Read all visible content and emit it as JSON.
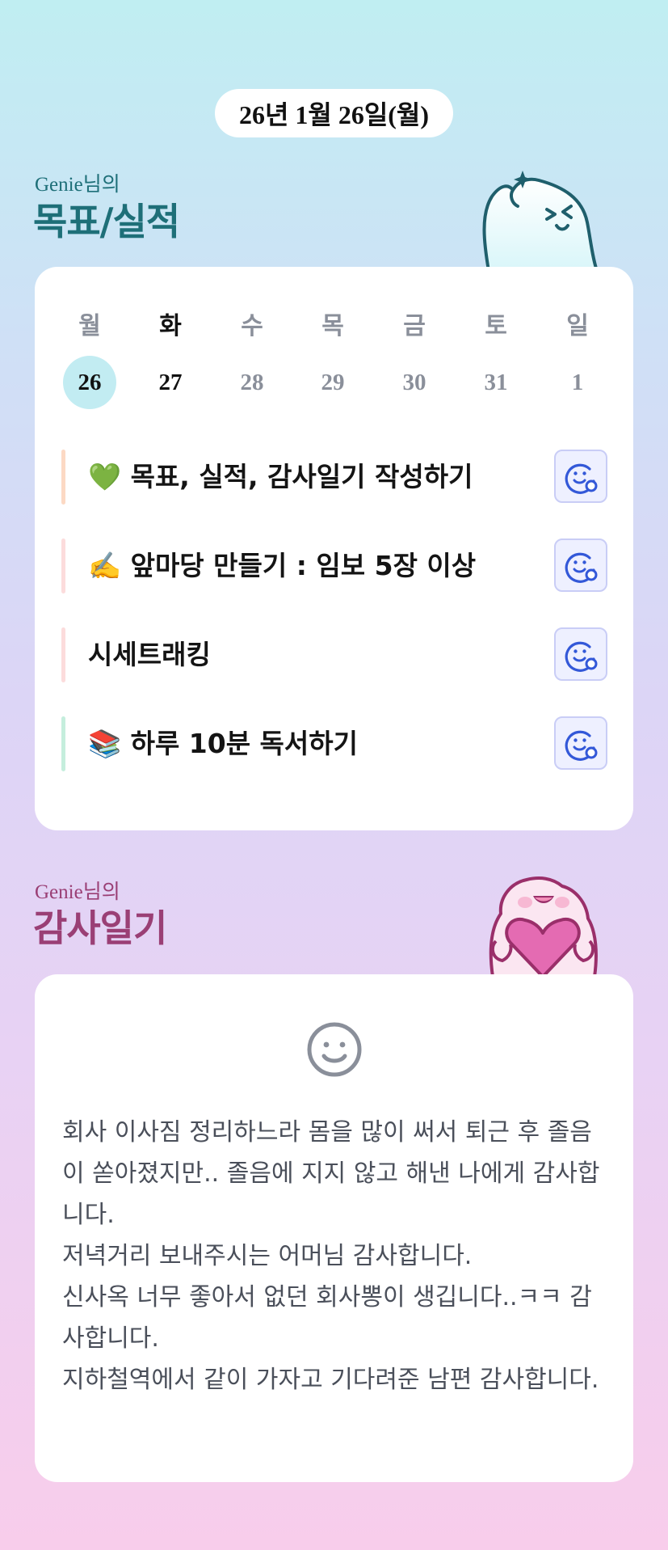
{
  "header": {
    "date": "26년 1월 26일(월)"
  },
  "goals_section": {
    "subtitle": "Genie님의",
    "title": "목표/실적",
    "weekdays": [
      "월",
      "화",
      "수",
      "목",
      "금",
      "토",
      "일"
    ],
    "dates": [
      "26",
      "27",
      "28",
      "29",
      "30",
      "31",
      "1"
    ],
    "selected_index": 0,
    "items": [
      {
        "text": "💚 목표, 실적, 감사일기 작성하기",
        "bar_color": "#fcd9c4"
      },
      {
        "text": "✍️ 앞마당 만들기 : 임보 5장 이상",
        "bar_color": "#fcdcdc"
      },
      {
        "text": "시세트래킹",
        "bar_color": "#fcdcdc"
      },
      {
        "text": "📚 하루 10분 독서하기",
        "bar_color": "#c5eedd"
      }
    ],
    "action_icon": "smiley-add-icon"
  },
  "diary_section": {
    "subtitle": "Genie님의",
    "title": "감사일기",
    "mood_icon": "smiley-icon",
    "body": "회사 이사짐 정리하느라 몸을 많이 써서 퇴근 후 졸음이 쏟아졌지만.. 졸음에 지지 않고 해낸 나에게 감사합니다.\n저녁거리 보내주시는 어머님 감사합니다.\n신사옥 너무 좋아서 없던 회사뽕이 생깁니다..ㅋㅋ 감사합니다.\n지하철역에서 같이 가자고 기다려준 남편 감사합니다."
  },
  "colors": {
    "goals_title": "#1e6f78",
    "diary_title": "#9a3f75",
    "today_highlight": "#c2ecf2",
    "action_icon": "#3358d8"
  }
}
